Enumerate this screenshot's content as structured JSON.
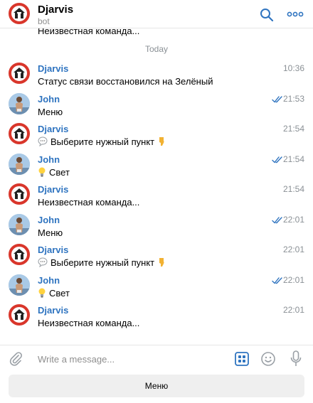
{
  "header": {
    "title": "Djarvis",
    "subtitle": "bot",
    "search_icon": "search-icon",
    "more_icon": "more-icon"
  },
  "scrolled_text": "Неизвестная команда...",
  "date_separator": "Today",
  "messages": [
    {
      "sender": "Djarvis",
      "text": "Статус связи восстановился на Зелёный",
      "time": "10:36",
      "read": false
    },
    {
      "sender": "John",
      "text": "Меню",
      "time": "21:53",
      "read": true
    },
    {
      "sender": "Djarvis",
      "text": "Выберите нужный пункт",
      "time": "21:54",
      "read": false,
      "prefix_icon": "speech-balloon-icon",
      "suffix_icon": "pointing-down-icon"
    },
    {
      "sender": "John",
      "text": "Свет",
      "time": "21:54",
      "read": true,
      "prefix_icon": "light-bulb-icon"
    },
    {
      "sender": "Djarvis",
      "text": "Неизвестная команда...",
      "time": "21:54",
      "read": false
    },
    {
      "sender": "John",
      "text": "Меню",
      "time": "22:01",
      "read": true
    },
    {
      "sender": "Djarvis",
      "text": "Выберите нужный пункт",
      "time": "22:01",
      "read": false,
      "prefix_icon": "speech-balloon-icon",
      "suffix_icon": "pointing-down-icon"
    },
    {
      "sender": "John",
      "text": "Свет",
      "time": "22:01",
      "read": true,
      "prefix_icon": "light-bulb-icon"
    },
    {
      "sender": "Djarvis",
      "text": "Неизвестная команда...",
      "time": "22:01",
      "read": false
    }
  ],
  "composer": {
    "placeholder": "Write a message...",
    "attach_icon": "paperclip-icon",
    "keyboard_icon": "bot-keyboard-icon",
    "emoji_icon": "smiley-icon",
    "mic_icon": "microphone-icon"
  },
  "bot_keyboard": {
    "button_label": "Меню"
  },
  "colors": {
    "accent": "#2f74c0",
    "bot_avatar_ring": "#d9362b",
    "muted": "#8a9095"
  }
}
